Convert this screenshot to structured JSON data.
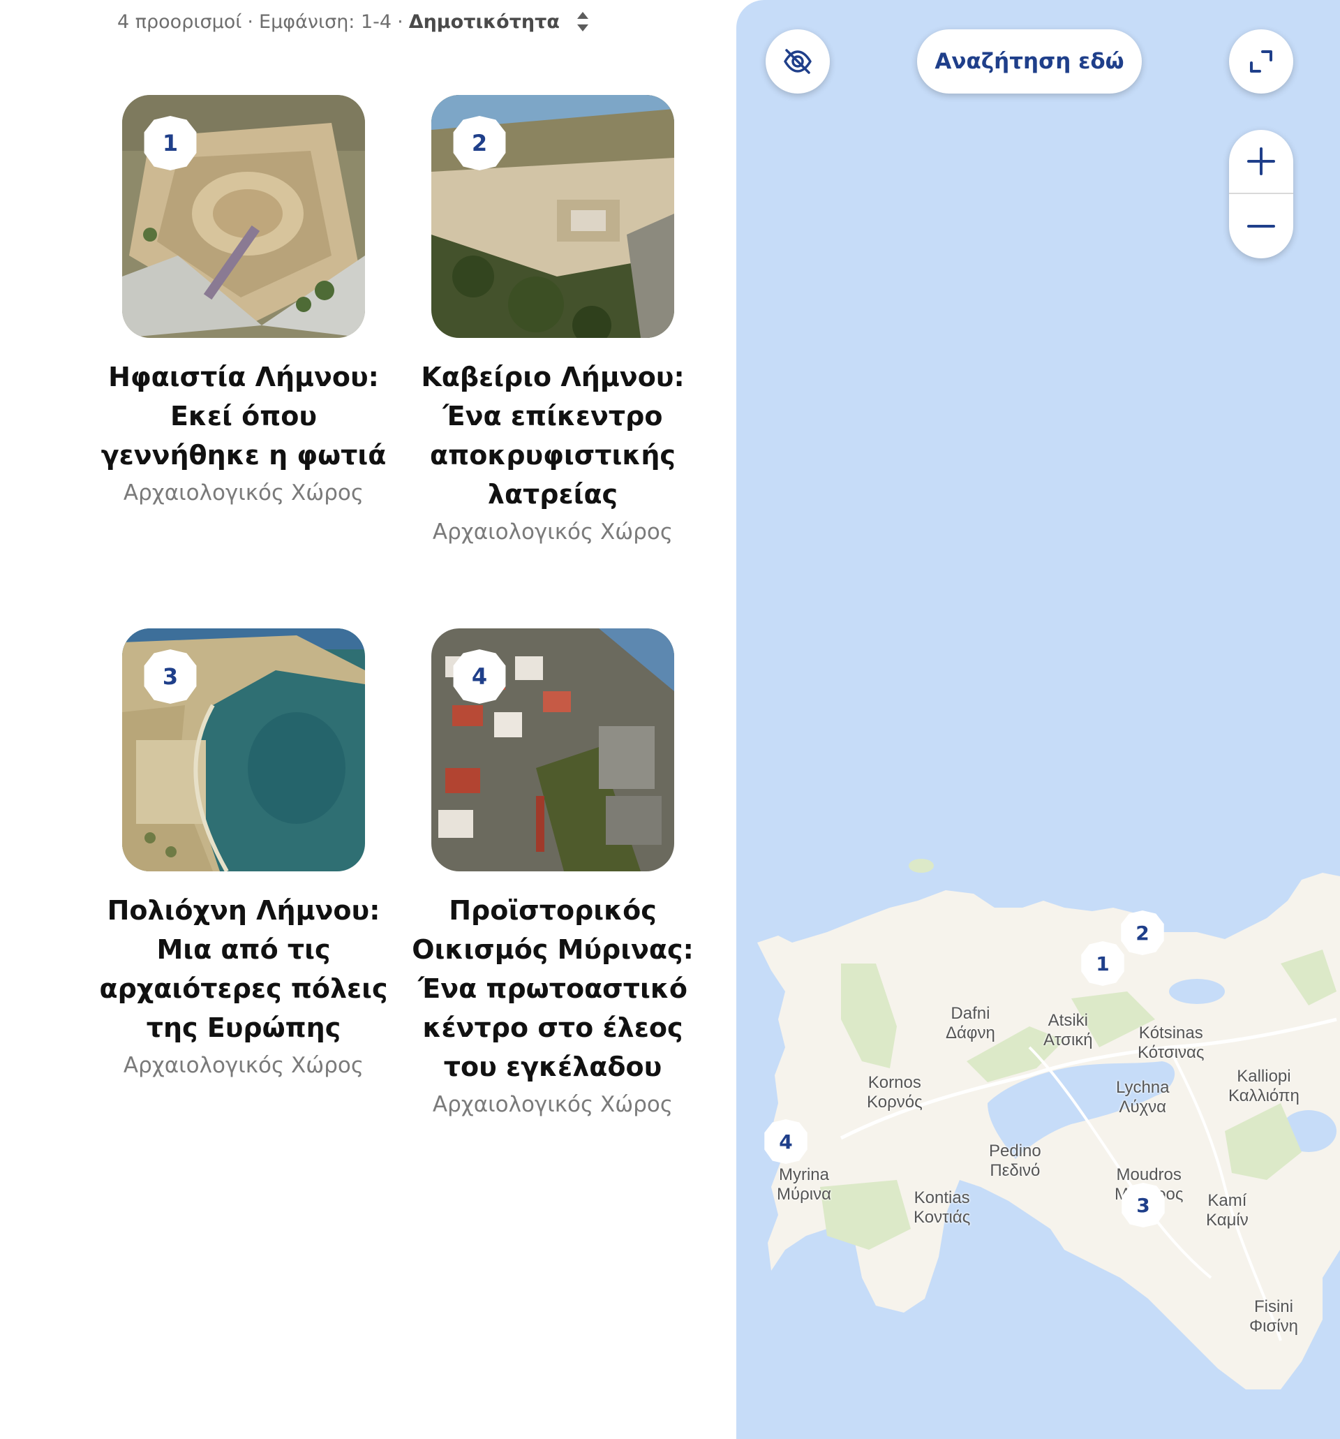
{
  "summary": {
    "count": "4 προορισμοί",
    "showing": "Εμφάνιση: 1-4",
    "sort_label": "Δημοτικότητα"
  },
  "cards": [
    {
      "number": "1",
      "title": "Ηφαιστία Λήμνου: Εκεί όπου γεννήθηκε η φωτιά",
      "category": "Αρχαιολογικός Χώρος"
    },
    {
      "number": "2",
      "title": "Καβείριο Λήμνου: Ένα επίκεντρο αποκρυφιστικής λατρείας",
      "category": "Αρχαιολογικός Χώρος"
    },
    {
      "number": "3",
      "title": "Πολιόχνη Λήμνου: Μια από τις αρχαιότερες πόλεις της Ευρώπης",
      "category": "Αρχαιολογικός Χώρος"
    },
    {
      "number": "4",
      "title": "Προϊστορικός Οικισμός Μύρινας: Ένα πρωτοαστικό κέντρο στο έλεος του εγκέλαδου",
      "category": "Αρχαιολογικός Χώρος"
    }
  ],
  "map": {
    "search_here_label": "Αναζήτηση εδώ",
    "toggle_icon": "eye-slash-icon",
    "expand_icon": "expand-icon",
    "zoom_in_icon": "plus-icon",
    "zoom_out_icon": "minus-icon",
    "pins": [
      "1",
      "2",
      "3",
      "4"
    ],
    "places": [
      {
        "latin": "Dafni",
        "greek": "Δάφνη"
      },
      {
        "latin": "Atsiki",
        "greek": "Ατσική"
      },
      {
        "latin": "Kótsinas",
        "greek": "Κότσινας"
      },
      {
        "latin": "Kalliopi",
        "greek": "Καλλιόπη"
      },
      {
        "latin": "Kornos",
        "greek": "Κορνός"
      },
      {
        "latin": "Lychna",
        "greek": "Λύχνα"
      },
      {
        "latin": "Myrina",
        "greek": "Μύρινα"
      },
      {
        "latin": "Pedino",
        "greek": "Πεδινό"
      },
      {
        "latin": "Moudros",
        "greek": "Μούδρος"
      },
      {
        "latin": "Kontias",
        "greek": "Κοντιάς"
      },
      {
        "latin": "Kamí",
        "greek": "Καμίν"
      },
      {
        "latin": "Fisini",
        "greek": "Φισίνη"
      }
    ],
    "colors": {
      "water": "#c6dcf8",
      "land": "#f6f3ec",
      "park": "#dce9c8",
      "accent": "#1f3f8a"
    }
  }
}
